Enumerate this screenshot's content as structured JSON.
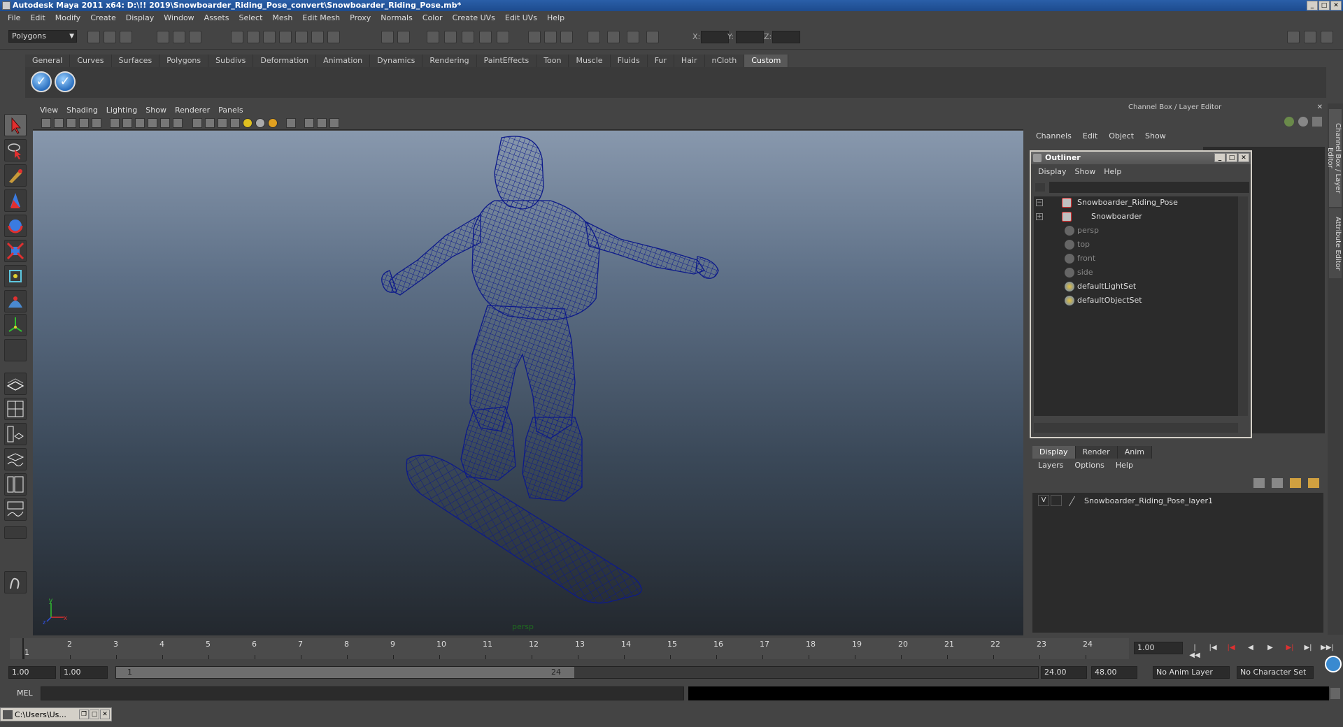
{
  "window": {
    "title": "Autodesk Maya 2011 x64: D:\\!! 2019\\Snowboarder_Riding_Pose_convert\\Snowboarder_Riding_Pose.mb*"
  },
  "menubar": [
    "File",
    "Edit",
    "Modify",
    "Create",
    "Display",
    "Window",
    "Assets",
    "Select",
    "Mesh",
    "Edit Mesh",
    "Proxy",
    "Normals",
    "Color",
    "Create UVs",
    "Edit UVs",
    "Help"
  ],
  "statusline": {
    "mode": "Polygons",
    "x_label": "X:",
    "y_label": "Y:",
    "z_label": "Z:"
  },
  "shelf": {
    "tabs": [
      "General",
      "Curves",
      "Surfaces",
      "Polygons",
      "Subdivs",
      "Deformation",
      "Animation",
      "Dynamics",
      "Rendering",
      "PaintEffects",
      "Toon",
      "Muscle",
      "Fluids",
      "Fur",
      "Hair",
      "nCloth",
      "Custom"
    ],
    "active_tab": "Custom"
  },
  "viewport": {
    "menu": [
      "View",
      "Shading",
      "Lighting",
      "Show",
      "Renderer",
      "Panels"
    ],
    "camera_label": "persp",
    "axis_y": "y",
    "axis_x": "x",
    "axis_z": "z"
  },
  "channel_box": {
    "header": "Channel Box / Layer Editor",
    "menu": [
      "Channels",
      "Edit",
      "Object",
      "Show"
    ]
  },
  "side_tabs": [
    "Channel Box / Layer Editor",
    "Attribute Editor"
  ],
  "outliner": {
    "title": "Outliner",
    "menu": [
      "Display",
      "Show",
      "Help"
    ],
    "items": [
      {
        "label": "Snowboarder_Riding_Pose",
        "kind": "group"
      },
      {
        "label": "Snowboarder",
        "kind": "mesh"
      },
      {
        "label": "persp",
        "kind": "camera"
      },
      {
        "label": "top",
        "kind": "camera"
      },
      {
        "label": "front",
        "kind": "camera"
      },
      {
        "label": "side",
        "kind": "camera"
      },
      {
        "label": "defaultLightSet",
        "kind": "set"
      },
      {
        "label": "defaultObjectSet",
        "kind": "set"
      }
    ]
  },
  "layer_editor": {
    "tabs": [
      "Display",
      "Render",
      "Anim"
    ],
    "menu": [
      "Layers",
      "Options",
      "Help"
    ],
    "layer": {
      "visible": "V",
      "name": "Snowboarder_Riding_Pose_layer1"
    }
  },
  "timeline": {
    "ticks": [
      "1",
      "2",
      "3",
      "4",
      "5",
      "6",
      "7",
      "8",
      "9",
      "10",
      "11",
      "12",
      "13",
      "14",
      "15",
      "16",
      "17",
      "18",
      "19",
      "20",
      "21",
      "22",
      "23",
      "24"
    ],
    "current_frame_marker": "1",
    "current_time": "1.00"
  },
  "range": {
    "start": "1.00",
    "playback_start": "1.00",
    "slider_start": "1",
    "slider_end": "24",
    "playback_end": "24.00",
    "end": "48.00",
    "anim_layer": "No Anim Layer",
    "character_set": "No Character Set"
  },
  "commandline": {
    "label": "MEL"
  },
  "taskbar": {
    "label": "C:\\Users\\Us..."
  }
}
